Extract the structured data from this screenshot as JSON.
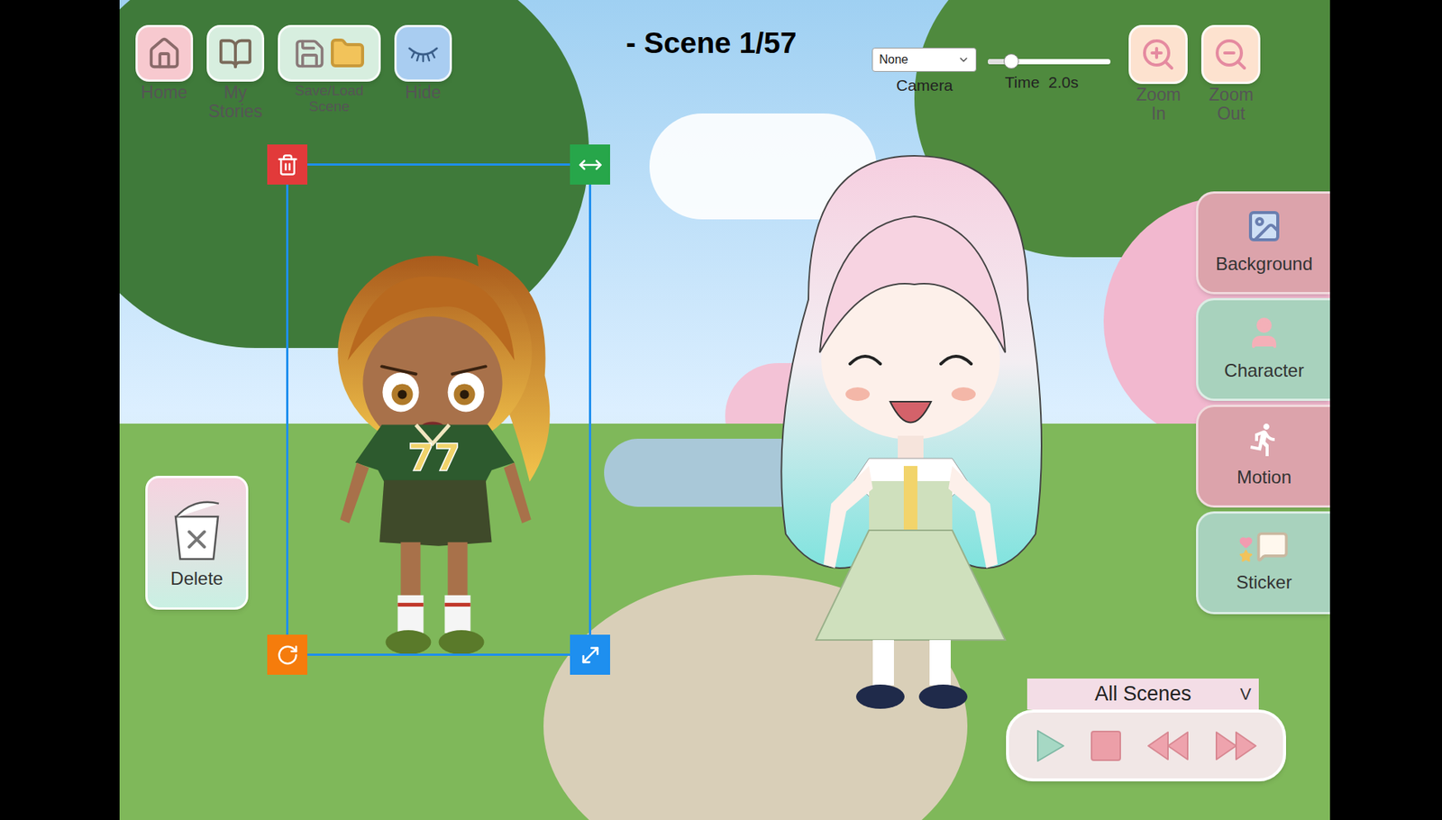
{
  "toolbar": {
    "buttons": [
      {
        "label": "Home"
      },
      {
        "label": "My Stories"
      },
      {
        "label": "Save/Load Scene"
      },
      {
        "label": "Hide"
      }
    ]
  },
  "scene_title": "- Scene 1/57",
  "camera": {
    "value": "None",
    "label": "Camera"
  },
  "time": {
    "label": "Time  2.0s",
    "level": 0.19
  },
  "zoom": [
    {
      "label": "Zoom In"
    },
    {
      "label": "Zoom Out"
    }
  ],
  "side_menu": [
    {
      "label": "Background"
    },
    {
      "label": "Character"
    },
    {
      "label": "Motion"
    },
    {
      "label": "Sticker"
    }
  ],
  "delete_zone": {
    "label": "Delete"
  },
  "playback": {
    "scope": "All Scenes",
    "scope_arrow": "V"
  },
  "characters": [
    {
      "kind": "sporty",
      "selected": true,
      "jersey": "77"
    },
    {
      "kind": "dress",
      "selected": false
    }
  ]
}
